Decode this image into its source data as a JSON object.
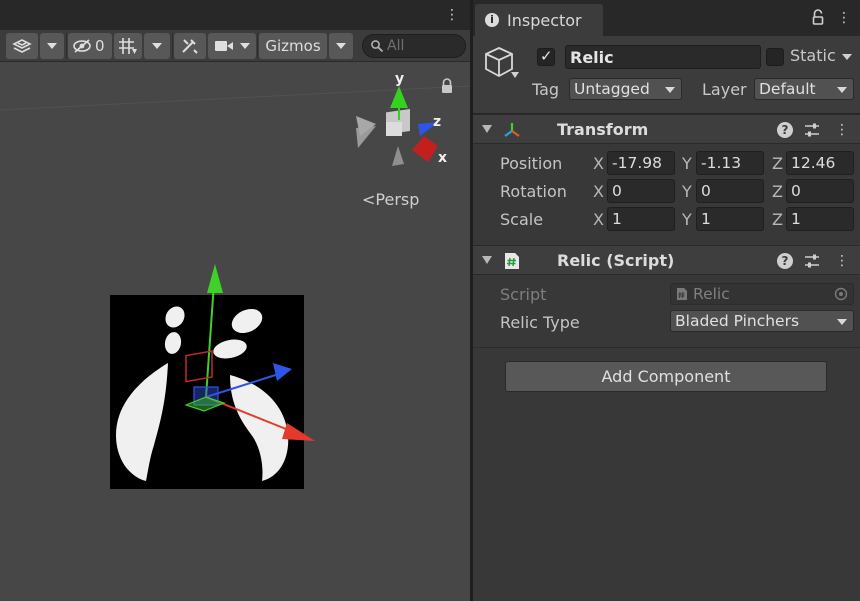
{
  "scene": {
    "toolbar": {
      "hidden_count": "0",
      "gizmos_label": "Gizmos",
      "search_placeholder": "All"
    },
    "orientation_gizmo": {
      "y_label": "y",
      "z_label": "z",
      "x_label": "x"
    },
    "projection_label": "Persp"
  },
  "inspector": {
    "tab_label": "Inspector",
    "gameobject": {
      "name": "Relic",
      "active": true,
      "static_label": "Static",
      "tag_label": "Tag",
      "tag_value": "Untagged",
      "layer_label": "Layer",
      "layer_value": "Default"
    },
    "transform": {
      "title": "Transform",
      "position_label": "Position",
      "rotation_label": "Rotation",
      "scale_label": "Scale",
      "position": {
        "x": "-17.98",
        "y": "-1.13",
        "z": "12.46"
      },
      "rotation": {
        "x": "0",
        "y": "0",
        "z": "0"
      },
      "scale": {
        "x": "1",
        "y": "1",
        "z": "1"
      },
      "axis_x": "X",
      "axis_y": "Y",
      "axis_z": "Z"
    },
    "relic_script": {
      "title": "Relic (Script)",
      "script_label": "Script",
      "script_value": "Relic",
      "relic_type_label": "Relic Type",
      "relic_type_value": "Bladed Pinchers"
    },
    "add_component_label": "Add Component"
  },
  "colors": {
    "axis_x": "#e23b2e",
    "axis_y": "#3ed12a",
    "axis_z": "#2f55e8"
  }
}
